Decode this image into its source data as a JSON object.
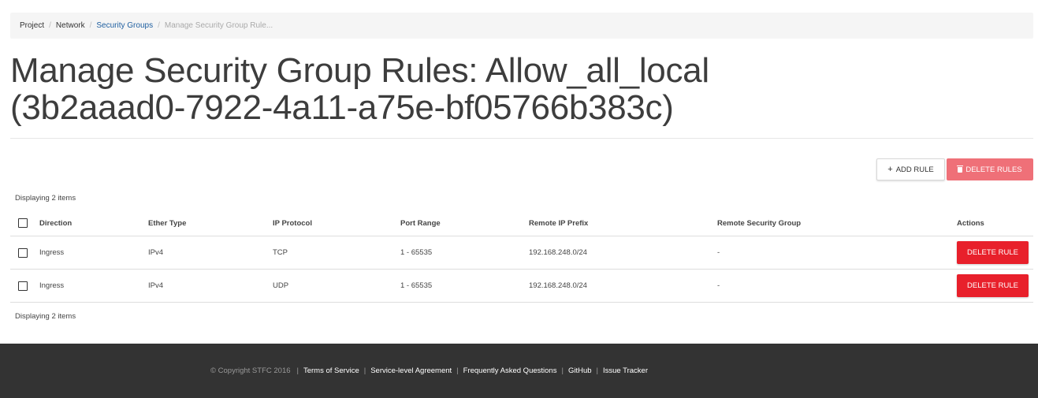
{
  "breadcrumb": {
    "items": [
      "Project",
      "Network",
      "Security Groups",
      "Manage Security Group Rule..."
    ]
  },
  "page": {
    "title_line1": "Manage Security Group Rules: Allow_all_local",
    "title_line2": "(3b2aaad0-7922-4a11-a75e-bf05766b383c)"
  },
  "toolbar": {
    "add_rule": "ADD RULE",
    "add_icon": "plus-icon",
    "delete_rules": "DELETE RULES",
    "delete_icon": "trash-icon"
  },
  "table": {
    "count_text": "Displaying 2 items",
    "headers": {
      "direction": "Direction",
      "ether_type": "Ether Type",
      "ip_protocol": "IP Protocol",
      "port_range": "Port Range",
      "remote_ip_prefix": "Remote IP Prefix",
      "remote_security_group": "Remote Security Group",
      "actions": "Actions"
    },
    "rows": [
      {
        "direction": "Ingress",
        "ether_type": "IPv4",
        "ip_protocol": "TCP",
        "port_range": "1 - 65535",
        "remote_ip_prefix": "192.168.248.0/24",
        "remote_security_group": "-",
        "action": "DELETE RULE"
      },
      {
        "direction": "Ingress",
        "ether_type": "IPv4",
        "ip_protocol": "UDP",
        "port_range": "1 - 65535",
        "remote_ip_prefix": "192.168.248.0/24",
        "remote_security_group": "-",
        "action": "DELETE RULE"
      }
    ]
  },
  "footer": {
    "copyright": "© Copyright STFC 2016",
    "links": [
      "Terms of Service",
      "Service-level Agreement",
      "Frequently Asked Questions",
      "GitHub",
      "Issue Tracker"
    ]
  },
  "colors": {
    "primary_danger": "#e8202b",
    "danger_disabled": "#ef7078",
    "footer_bg": "#333333",
    "breadcrumb_link": "#1f5fa0"
  }
}
